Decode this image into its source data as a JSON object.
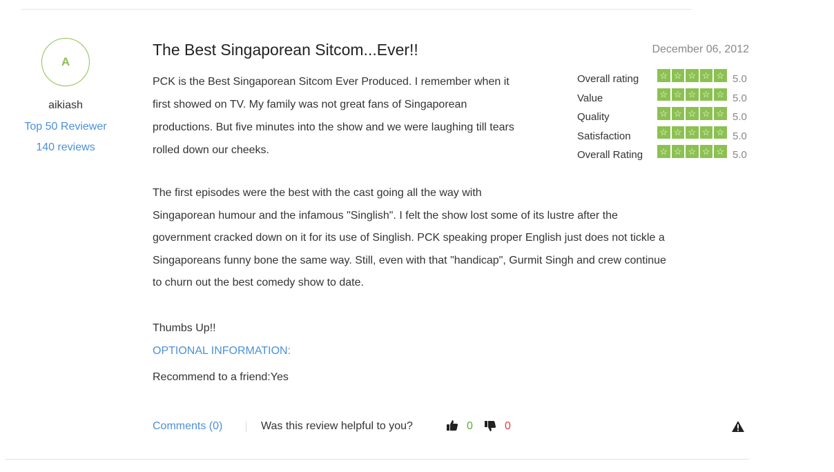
{
  "reviewer": {
    "initial": "A",
    "name": "aikiash",
    "rank": "Top 50 Reviewer",
    "reviews": "140 reviews"
  },
  "review": {
    "title": "The Best Singaporean Sitcom...Ever!!",
    "date": "December 06, 2012",
    "paragraph1_lines": [
      "PCK is the Best Singaporean Sitcom Ever Produced. I remember when it",
      "first showed on TV. My family was not great fans of Singaporean",
      "productions. But five minutes into the show and we were laughing till tears",
      "rolled down our cheeks."
    ],
    "paragraph2_lines": [
      "The first episodes were the best with the cast going all the way with",
      "Singaporean humour and the infamous \"Singlish\". I felt the show lost some of its lustre after the",
      "government cracked down on it for its use of Singlish. PCK speaking proper English just does not tickle a",
      "Singaporeans funny bone the same way. Still, even with that \"handicap\", Gurmit Singh and crew continue",
      "to churn out the best comedy show to date."
    ],
    "closing": "Thumbs Up!!",
    "optional_header": "OPTIONAL INFORMATION:",
    "recommend": "Recommend to a friend:Yes"
  },
  "ratings": [
    {
      "label": "Overall rating",
      "stars": 5,
      "value": "5.0"
    },
    {
      "label": "Value",
      "stars": 5,
      "value": "5.0"
    },
    {
      "label": "Quality",
      "stars": 5,
      "value": "5.0"
    },
    {
      "label": "Satisfaction",
      "stars": 5,
      "value": "5.0"
    },
    {
      "label": "Overall Rating",
      "stars": 5,
      "value": "5.0"
    }
  ],
  "footer": {
    "comments": "Comments (0)",
    "helpful_question": "Was this review helpful to you?",
    "up_count": "0",
    "down_count": "0"
  },
  "colors": {
    "accent_green": "#8cc152",
    "link_blue": "#4a90d9",
    "up_green": "#5aaa3c",
    "down_red": "#e03c3c"
  },
  "icons": [
    "thumbs-up-icon",
    "thumbs-down-icon",
    "warning-icon",
    "star-icon"
  ]
}
